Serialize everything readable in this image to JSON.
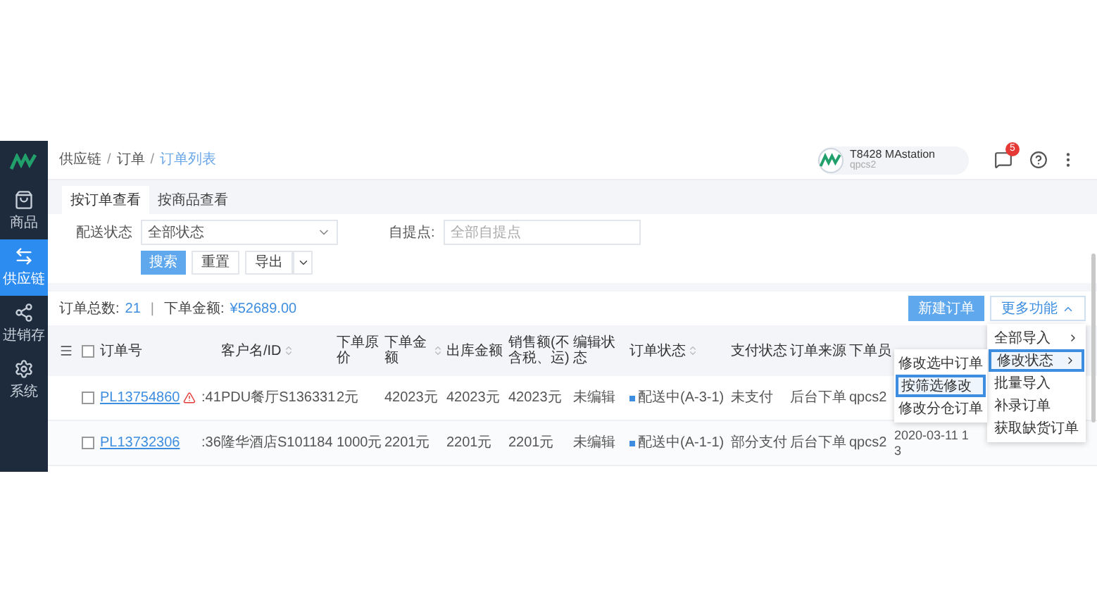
{
  "sidebar": {
    "items": [
      {
        "label": "商品",
        "selected": false
      },
      {
        "label": "供应链",
        "selected": true
      },
      {
        "label": "进销存",
        "selected": false
      },
      {
        "label": "系统",
        "selected": false
      }
    ]
  },
  "breadcrumb": {
    "separator": "/",
    "items": [
      "供应链",
      "订单",
      "订单列表"
    ]
  },
  "account": {
    "name": "T8428 MAstation",
    "sub": "qpcs2",
    "badge": "5"
  },
  "view_tabs": [
    {
      "label": "按订单查看",
      "selected": true
    },
    {
      "label": "按商品查看",
      "selected": false
    }
  ],
  "filters": {
    "status_label": "配送状态",
    "status_value": "全部状态",
    "pickup_label": "自提点:",
    "pickup_placeholder": "全部自提点"
  },
  "filter_buttons": [
    {
      "label": "搜索",
      "kind": "primary"
    },
    {
      "label": "重置",
      "kind": "default"
    },
    {
      "label": "导出",
      "kind": "default"
    }
  ],
  "summary": {
    "count_label": "订单总数:",
    "count": "21",
    "separator": "|",
    "amount_label": "下单金额:",
    "amount": "¥52689.00"
  },
  "actions": [
    {
      "label": "新建订单",
      "kind": "primary"
    },
    {
      "label": "更多功能",
      "kind": "menu",
      "expanded": true
    }
  ],
  "more_menu": [
    {
      "label": "全部导入",
      "submenu": true,
      "selected": false
    },
    {
      "label": "修改状态",
      "submenu": true,
      "selected": true
    },
    {
      "label": "批量导入",
      "submenu": false,
      "selected": false
    },
    {
      "label": "补录订单",
      "submenu": false,
      "selected": false
    },
    {
      "label": "获取缺货订单",
      "submenu": false,
      "selected": false
    }
  ],
  "submenu": [
    {
      "label": "修改选中订单",
      "selected": false
    },
    {
      "label": "按筛选修改",
      "selected": true
    },
    {
      "label": "修改分仓订单",
      "selected": false
    }
  ],
  "table": {
    "header_checked": false,
    "columns": [
      {
        "label": "订单号",
        "kind": "link",
        "sortable": false
      },
      {
        "kind": "text"
      },
      {
        "label": "客户名/ID",
        "kind": "text",
        "sortable": true
      },
      {
        "label": "下单原价",
        "kind": "text",
        "sortable": false
      },
      {
        "label": "下单金额",
        "kind": "text",
        "sortable": true
      },
      {
        "label": "出库金额",
        "kind": "text",
        "sortable": false
      },
      {
        "label": "销售额(不含税、运)",
        "kind": "text",
        "sortable": false
      },
      {
        "label": "编辑状态",
        "kind": "text",
        "sortable": false
      },
      {
        "label": "订单状态",
        "kind": "status",
        "sortable": true
      },
      {
        "label": "支付状态",
        "kind": "text",
        "sortable": false
      },
      {
        "label": "订单来源",
        "kind": "text",
        "sortable": false
      },
      {
        "label": "下单员",
        "kind": "text",
        "sortable": false
      },
      {
        "kind": "text"
      }
    ],
    "rows": [
      {
        "checked": false,
        "warning": true,
        "cells": [
          "PL13754860",
          ":41",
          "PDU餐厅S136331",
          "2元",
          "42023元",
          "42023元",
          "42023元",
          "未编辑",
          "配送中(A-3-1)",
          "未支付",
          "后台下单",
          "qpcs2"
        ]
      },
      {
        "checked": false,
        "warning": false,
        "cells": [
          "PL13732306",
          ":36",
          "隆华酒店S101184",
          "1000元",
          "2201元",
          "2201元",
          "2201元",
          "未编辑",
          "配送中(A-1-1)",
          "部分支付",
          "后台下单",
          "qpcs2",
          [
            "2020-03-11 1",
            "3"
          ]
        ]
      }
    ]
  }
}
